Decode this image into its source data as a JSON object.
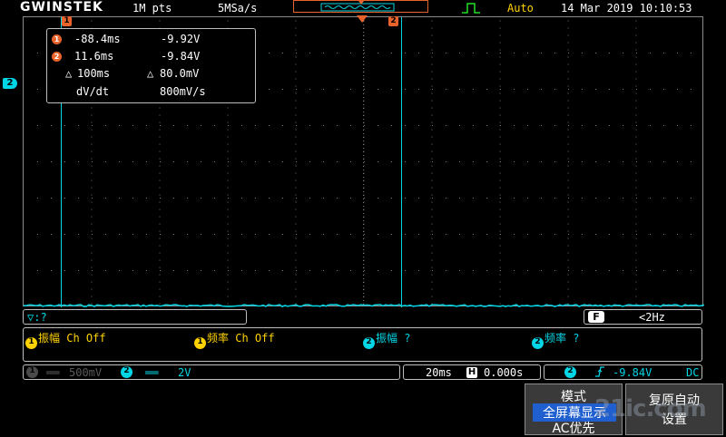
{
  "topbar": {
    "brand": "GWINSTEK",
    "record_length": "1M pts",
    "sample_rate": "5MSa/s",
    "trigger_mode": "Auto",
    "datetime": "14 Mar 2019 10:10:53"
  },
  "markers": {
    "cursor1": "1",
    "cursor2": "2",
    "ch2": "2"
  },
  "cursors": {
    "c1_time": "-88.4ms",
    "c1_volt": "-9.92V",
    "c2_time": "11.6ms",
    "c2_volt": "-9.84V",
    "delta_time": "100ms",
    "delta_volt": "80.0mV",
    "dvdt_label": "dV/dt",
    "dvdt_value": "800mV/s",
    "delta_symbol": "△"
  },
  "measure_bar": {
    "label": "▽:?",
    "filter_icon": "F",
    "freq": "<2Hz"
  },
  "measurements": [
    {
      "num": "1",
      "text": "振幅 Ch Off"
    },
    {
      "num": "1",
      "text": "频率 Ch Off"
    },
    {
      "num": "2",
      "text": "振幅 ?"
    },
    {
      "num": "2",
      "text": "频率 ?"
    }
  ],
  "channels": {
    "ch1_num": "1",
    "ch1_scale": "500mV",
    "ch2_num": "2",
    "ch2_scale": "2V"
  },
  "timebase": {
    "scale": "20ms",
    "h_icon": "H",
    "position": "0.000s"
  },
  "trigger": {
    "source": "2",
    "level": "-9.84V",
    "coupling": "DC"
  },
  "softkeys": {
    "mode_title": "模式",
    "mode_option1": "全屏幕显示",
    "mode_option2": "AC优先",
    "reset_line1": "复原自动",
    "reset_line2": "设置"
  },
  "watermark": "21ic.com",
  "colors": {
    "ch1": "#ffd200",
    "ch2": "#00d6e6",
    "cursor": "#e8632b",
    "highlight": "#1f5fd0"
  }
}
